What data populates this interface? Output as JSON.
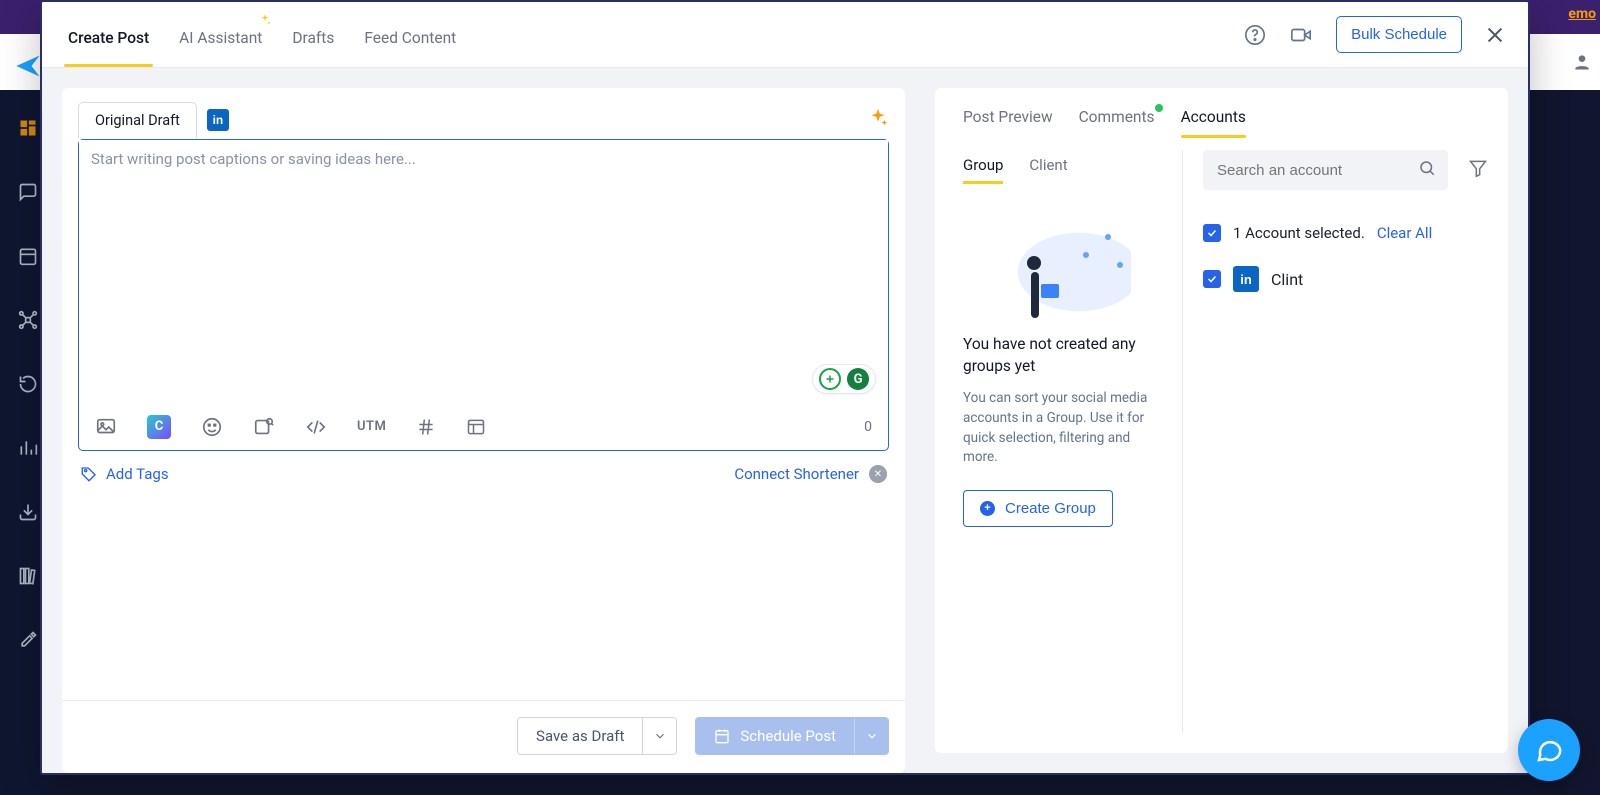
{
  "background": {
    "demo_link": "emo"
  },
  "header": {
    "tabs": {
      "create_post": "Create Post",
      "ai_assistant": "AI Assistant",
      "drafts": "Drafts",
      "feed_content": "Feed Content"
    },
    "bulk_schedule": "Bulk Schedule"
  },
  "editor": {
    "draft_tab": "Original Draft",
    "placeholder": "Start writing post captions or saving ideas here...",
    "utm_label": "UTM",
    "char_count": "0",
    "add_tags": "Add Tags",
    "connect_shortener": "Connect Shortener"
  },
  "footer": {
    "save_as_draft": "Save as Draft",
    "schedule_post": "Schedule Post"
  },
  "right": {
    "tabs": {
      "post_preview": "Post Preview",
      "comments": "Comments",
      "accounts": "Accounts"
    },
    "subtabs": {
      "group": "Group",
      "client": "Client"
    },
    "groups": {
      "empty_title": "You have not created any groups yet",
      "empty_desc": "You can sort your social media accounts in a Group. Use it for quick selection, filtering and more.",
      "create_button": "Create Group"
    },
    "search_placeholder": "Search an account",
    "selected_text": "1 Account selected.",
    "clear_all": "Clear All",
    "accounts": [
      {
        "name": "Clint",
        "network": "linkedin",
        "checked": true
      }
    ]
  }
}
